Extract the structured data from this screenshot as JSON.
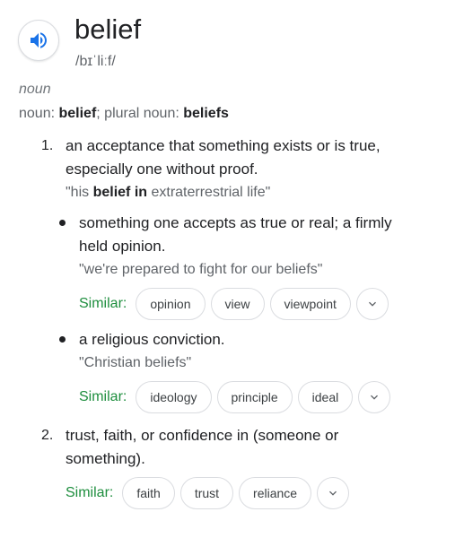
{
  "word": "belief",
  "phonetic": "/bɪˈliːf/",
  "part_of_speech": "noun",
  "forms": {
    "noun_label": "noun",
    "noun_value": "belief",
    "plural_label": "; plural noun",
    "plural_value": "beliefs"
  },
  "senses": [
    {
      "number": "1.",
      "definition_line1": "an acceptance that something exists or is true,",
      "definition_line2": "especially one without proof.",
      "example_prefix": "\"his ",
      "example_bold": "belief in",
      "example_suffix": " extraterrestrial life\"",
      "subsenses": [
        {
          "definition_line1": "something one accepts as true or real; a firmly",
          "definition_line2": "held opinion.",
          "example": "\"we're prepared to fight for our beliefs\"",
          "similar_label": "Similar:",
          "similar": [
            "opinion",
            "view",
            "viewpoint"
          ]
        },
        {
          "definition": "a religious conviction.",
          "example": "\"Christian beliefs\"",
          "similar_label": "Similar:",
          "similar": [
            "ideology",
            "principle",
            "ideal"
          ]
        }
      ]
    },
    {
      "number": "2.",
      "definition_line1": "trust, faith, or confidence in (someone or",
      "definition_line2": "something).",
      "similar_label": "Similar:",
      "similar": [
        "faith",
        "trust",
        "reliance"
      ]
    }
  ],
  "colors": {
    "accent_blue": "#1a73e8",
    "similar_green": "#1e8e3e",
    "text": "#202124",
    "secondary": "#5f6368"
  },
  "icons": {
    "speaker": "volume-up-icon",
    "expand": "chevron-down-icon"
  }
}
